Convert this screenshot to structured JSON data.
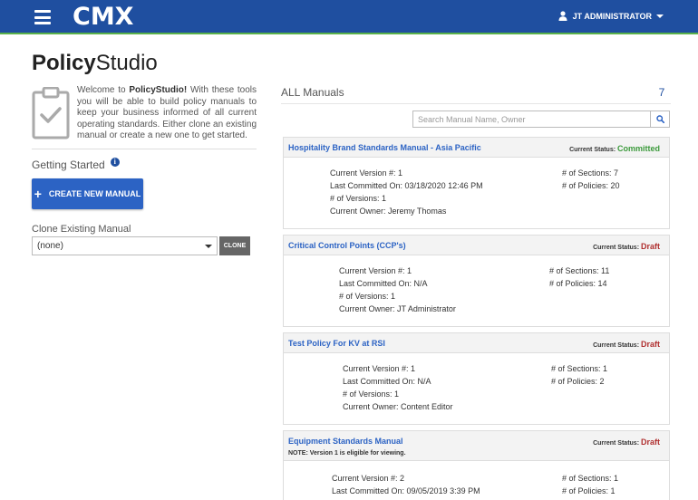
{
  "header": {
    "logo": "CMX",
    "user_name": "JT ADMINISTRATOR"
  },
  "page": {
    "title_bold": "Policy",
    "title_rest": "Studio"
  },
  "intro": {
    "welcome": "Welcome to ",
    "brand": "PolicyStudio!",
    "text": " With these tools you will be able to build policy manuals to keep your business informed of all current operating standards. Either clone an existing manual or create a new one to get started."
  },
  "getting_started": {
    "label": "Getting Started",
    "info": "i",
    "create_button": "CREATE NEW MANUAL",
    "create_icon": "+"
  },
  "clone": {
    "label": "Clone Existing Manual",
    "selected": "(none)",
    "button": "CLONE"
  },
  "manuals": {
    "heading": "ALL Manuals",
    "count": "7",
    "search_placeholder": "Search Manual Name, Owner",
    "status_label": "Current Status:",
    "items": [
      {
        "title": "Hospitality Brand Standards Manual - Asia Pacific",
        "status": "Committed",
        "version": "Current Version #: 1",
        "last_committed": "Last Committed On: 03/18/2020 12:46 PM",
        "versions": "# of Versions: 1",
        "owner": "Current Owner: Jeremy Thomas",
        "sections": "# of Sections: 7",
        "policies": "# of Policies: 20"
      },
      {
        "title": "Critical Control Points (CCP's)",
        "status": "Draft",
        "version": "Current Version #: 1",
        "last_committed": "Last Committed On: N/A",
        "versions": "# of Versions: 1",
        "owner": "Current Owner: JT Administrator",
        "sections": "# of Sections: 11",
        "policies": "# of Policies: 14"
      },
      {
        "title": "Test Policy For KV at RSI",
        "status": "Draft",
        "version": "Current Version #: 1",
        "last_committed": "Last Committed On: N/A",
        "versions": "# of Versions: 1",
        "owner": "Current Owner: Content Editor",
        "sections": "# of Sections: 1",
        "policies": "# of Policies: 2"
      },
      {
        "title": "Equipment Standards Manual",
        "note": "NOTE: Version 1 is eligible for viewing.",
        "status": "Draft",
        "version": "Current Version #: 2",
        "last_committed": "Last Committed On: 09/05/2019 3:39 PM",
        "sections": "# of Sections: 1",
        "policies": "# of Policies: 1"
      }
    ]
  },
  "colors": {
    "header_bg": "#1f4fa0",
    "header_accent": "#59b14a",
    "primary_button": "#2c63c4",
    "committed": "#3c9a3c",
    "draft": "#b03030"
  }
}
